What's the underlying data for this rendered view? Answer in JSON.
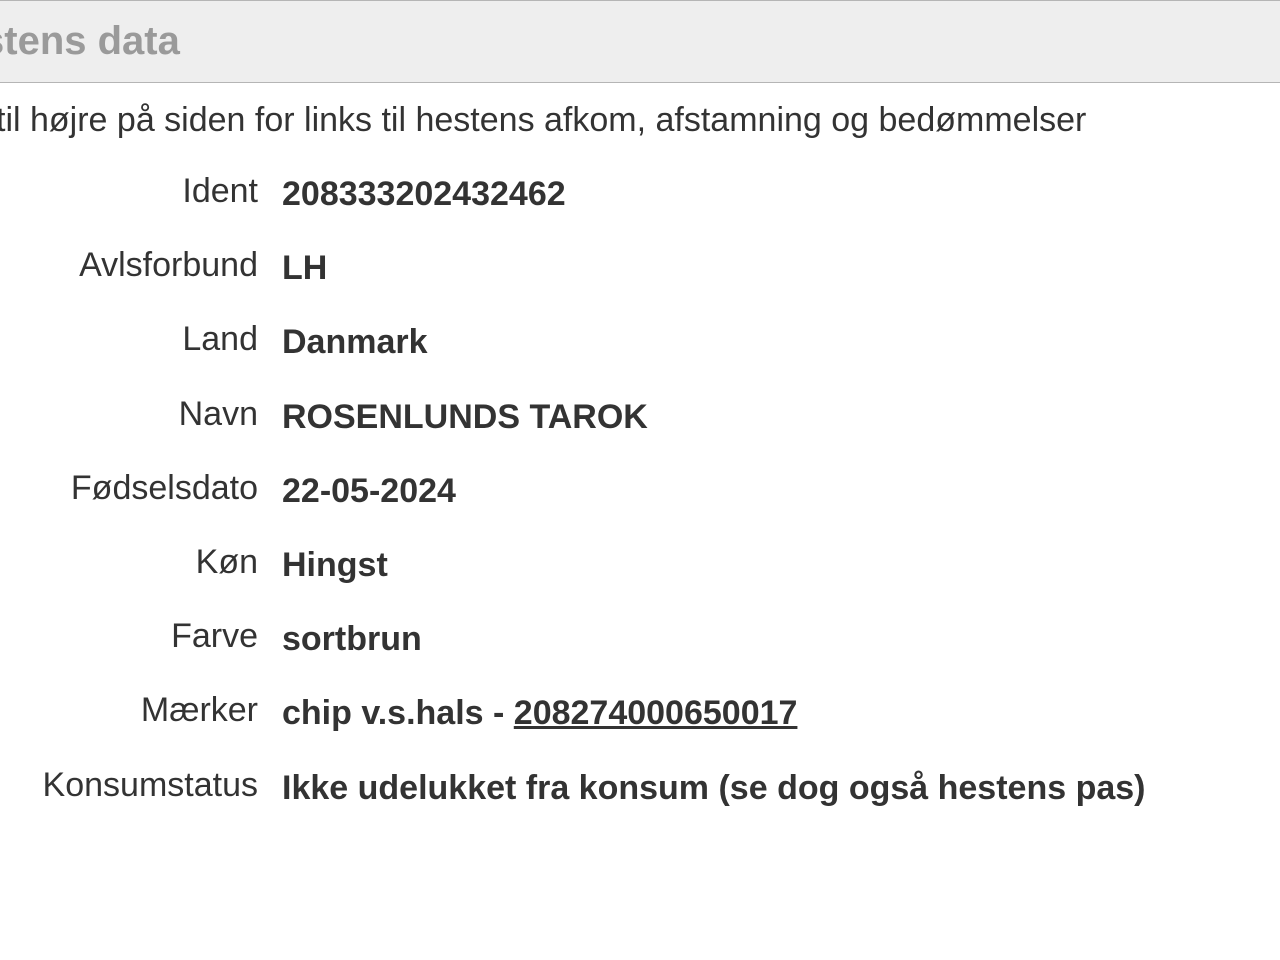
{
  "header": {
    "title": "stens data"
  },
  "intro": " til højre på siden for links til hestens afkom, afstamning og bedømmelser",
  "fields": {
    "ident": {
      "label": "Ident",
      "value": "208333202432462"
    },
    "avlsforbund": {
      "label": "Avlsforbund",
      "value": "LH"
    },
    "land": {
      "label": "Land",
      "value": "Danmark"
    },
    "navn": {
      "label": "Navn",
      "value": "ROSENLUNDS TAROK"
    },
    "fodselsdato": {
      "label": "Fødselsdato",
      "value": "22-05-2024"
    },
    "kon": {
      "label": "Køn",
      "value": "Hingst"
    },
    "farve": {
      "label": "Farve",
      "value": "sortbrun"
    },
    "maerker": {
      "label": "Mærker",
      "prefix": "chip v.s.hals - ",
      "chip": "208274000650017"
    },
    "konsumstatus": {
      "label": "Konsumstatus",
      "value": "Ikke udelukket fra konsum (se dog også hestens pas)"
    }
  }
}
